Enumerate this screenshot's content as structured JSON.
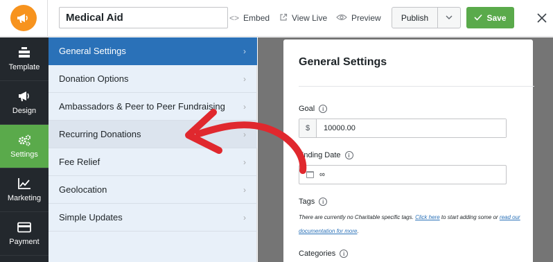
{
  "topbar": {
    "logo_icon": "megaphone-icon",
    "campaign_title": "Medical Aid",
    "embed_label": "Embed",
    "view_live_label": "View Live",
    "preview_label": "Preview",
    "publish_label": "Publish",
    "save_label": "Save",
    "close_icon": "close-icon"
  },
  "sidebar": {
    "items": [
      {
        "label": "Template",
        "icon": "template-icon"
      },
      {
        "label": "Design",
        "icon": "megaphone-icon"
      },
      {
        "label": "Settings",
        "icon": "gears-icon",
        "active": true
      },
      {
        "label": "Marketing",
        "icon": "chart-icon"
      },
      {
        "label": "Payment",
        "icon": "credit-card-icon"
      }
    ]
  },
  "settings_menu": {
    "items": [
      {
        "label": "General Settings",
        "active": true
      },
      {
        "label": "Donation Options"
      },
      {
        "label": "Ambassadors & Peer to Peer Fundraising"
      },
      {
        "label": "Recurring Donations"
      },
      {
        "label": "Fee Relief"
      },
      {
        "label": "Geolocation"
      },
      {
        "label": "Simple Updates"
      }
    ]
  },
  "panel": {
    "title": "General Settings",
    "goal": {
      "label": "Goal",
      "prefix": "$",
      "value": "10000.00"
    },
    "ending_date": {
      "label": "Ending Date",
      "value": "∞"
    },
    "tags": {
      "label": "Tags",
      "text_before": "There are currently no Charitable specific tags. ",
      "link1": "Click here",
      "text_middle": " to start adding some or ",
      "link2": "read our documentation for more",
      "text_after": "."
    },
    "categories": {
      "label": "Categories"
    }
  },
  "colors": {
    "accent_blue": "#2a71b8",
    "save_green": "#5aaa4b",
    "sidebar_dark": "#23282d",
    "logo_orange": "#f7931e",
    "annotation_red": "#e0282e"
  }
}
